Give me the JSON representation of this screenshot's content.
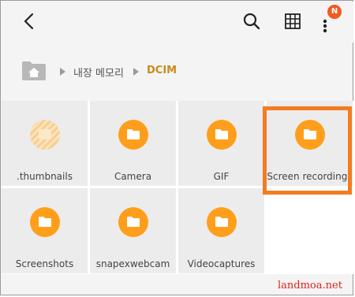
{
  "header": {
    "back_icon": "back-arrow-icon",
    "search_icon": "search-icon",
    "grid_icon": "grid-view-icon",
    "more_icon": "more-options-icon",
    "notification_badge": "N"
  },
  "breadcrumb": {
    "home_icon": "home-folder-icon",
    "items": [
      "내장 메모리",
      "DCIM"
    ],
    "current_color": "#c98a1a"
  },
  "folders": [
    {
      "name": ".thumbnails",
      "icon": "thumbnails-folder-icon"
    },
    {
      "name": "Camera",
      "icon": "folder-icon"
    },
    {
      "name": "GIF",
      "icon": "folder-icon"
    },
    {
      "name": "Screen recordings",
      "icon": "folder-icon",
      "highlighted": true
    },
    {
      "name": "Screenshots",
      "icon": "folder-icon"
    },
    {
      "name": "snapexwebcam",
      "icon": "folder-icon"
    },
    {
      "name": "Videocaptures",
      "icon": "folder-icon"
    }
  ],
  "colors": {
    "folder_accent": "#ff9e1b",
    "highlight_border": "#f47c20",
    "badge": "#f05a22"
  },
  "watermark": "landmoa.net"
}
